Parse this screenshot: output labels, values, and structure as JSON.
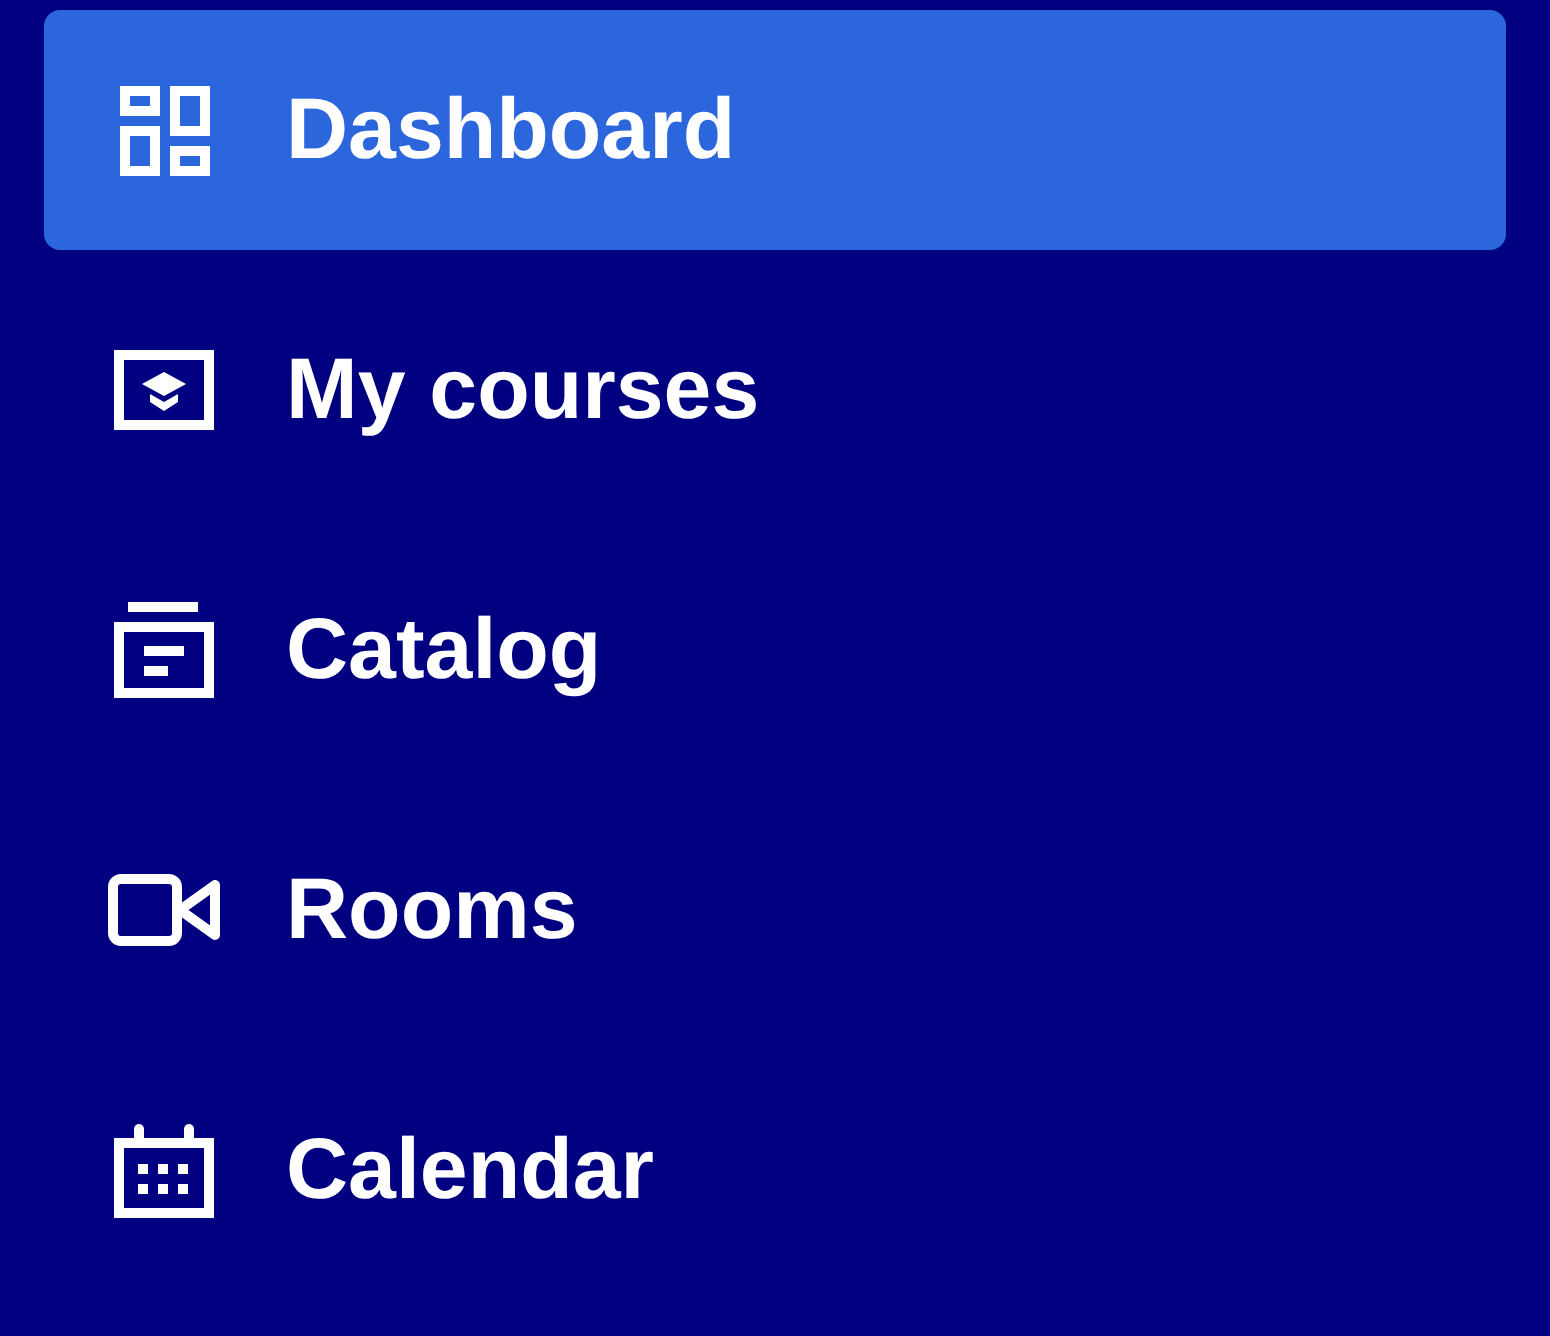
{
  "nav": {
    "items": [
      {
        "label": "Dashboard",
        "selected": true
      },
      {
        "label": "My courses",
        "selected": false
      },
      {
        "label": "Catalog",
        "selected": false
      },
      {
        "label": "Rooms",
        "selected": false
      },
      {
        "label": "Calendar",
        "selected": false
      }
    ]
  }
}
